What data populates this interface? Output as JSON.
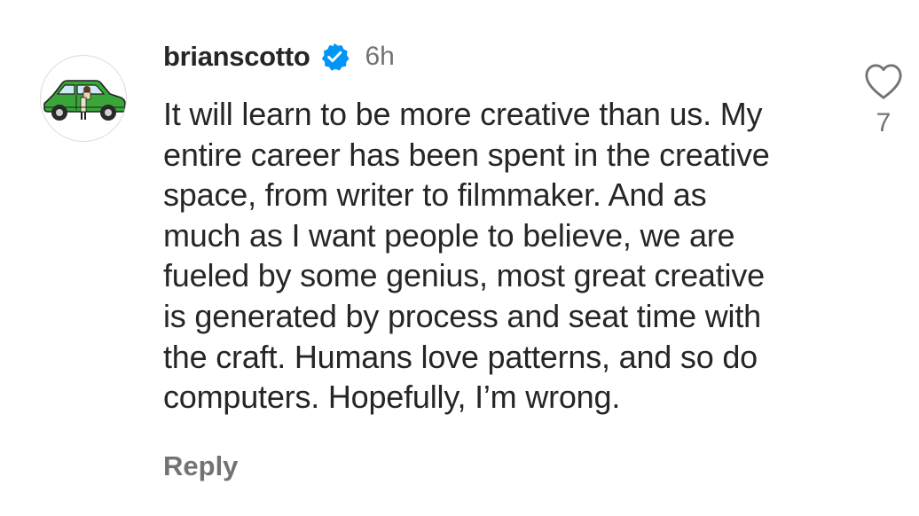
{
  "comment": {
    "username": "brianscotto",
    "verified_icon": "verified-badge-icon",
    "time": "6h",
    "body_lines": [
      "It will learn to be more creative than us. My",
      "entire career has been spent in the creative",
      "space, from writer to filmmaker. And as",
      "much as I want people to believe, we are",
      "fueled by some genius, most great creative",
      "is generated by process and seat time with",
      "the craft. Humans love patterns, and so do",
      "computers. Hopefully, I’m wrong."
    ],
    "reply_label": "Reply",
    "like_icon": "heart-outline-icon",
    "like_count": "7"
  },
  "colors": {
    "text_primary": "#262626",
    "text_secondary": "#737373",
    "verified_blue": "#0095f6",
    "avatar_car_green": "#3aa63a",
    "avatar_border": "#dbdbdb"
  }
}
